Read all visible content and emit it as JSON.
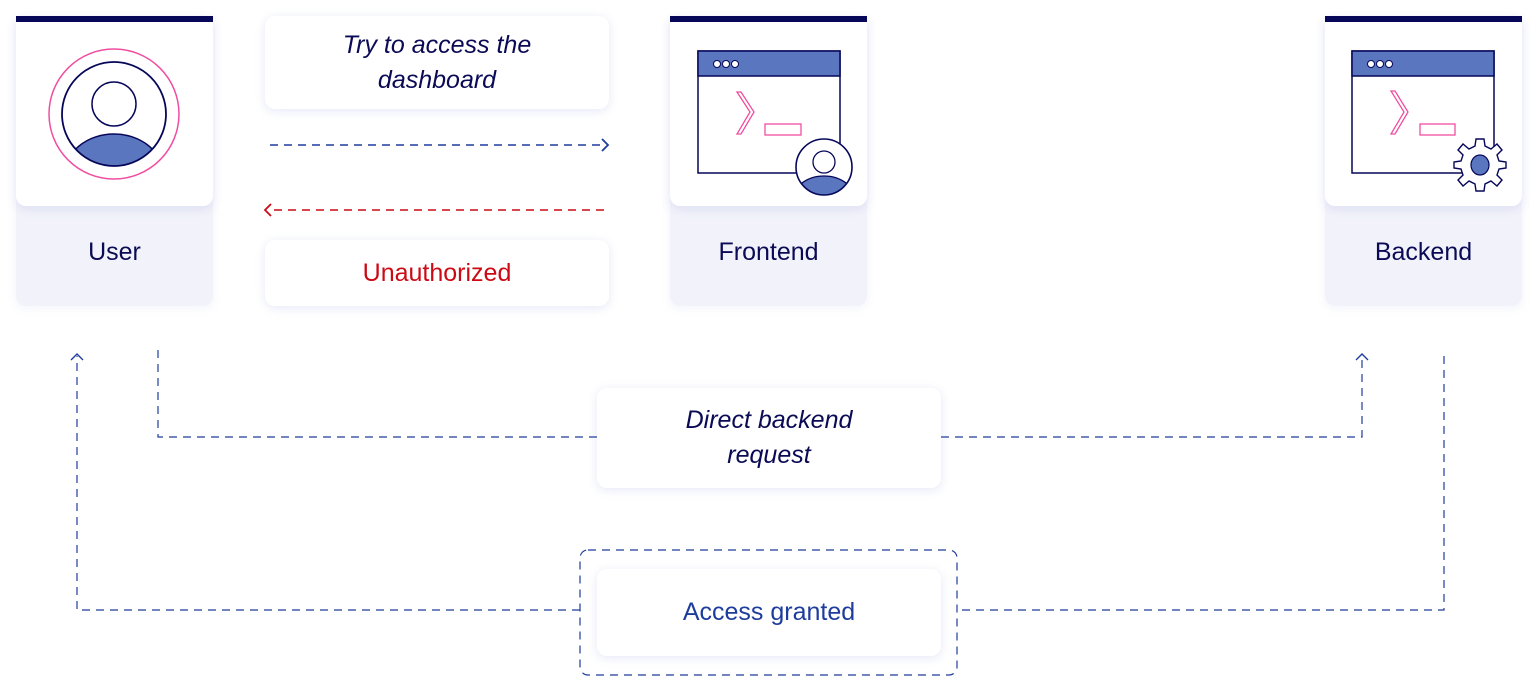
{
  "nodes": {
    "user": "User",
    "frontend": "Frontend",
    "backend": "Backend"
  },
  "messages": {
    "try_access": "Try to access the dashboard",
    "unauthorized": "Unauthorized",
    "direct_request": "Direct backend request",
    "access_granted": "Access granted"
  },
  "icons": {
    "user": "user-avatar-icon",
    "frontend": "browser-terminal-user-icon",
    "backend": "browser-terminal-gear-icon"
  },
  "colors": {
    "navy": "#07075a",
    "accent_blue": "#5a76be",
    "pink": "#f04ea0",
    "error_red": "#cc0a14",
    "arrow_blue": "#1e3c9c",
    "card_bg": "#f2f3fa"
  }
}
